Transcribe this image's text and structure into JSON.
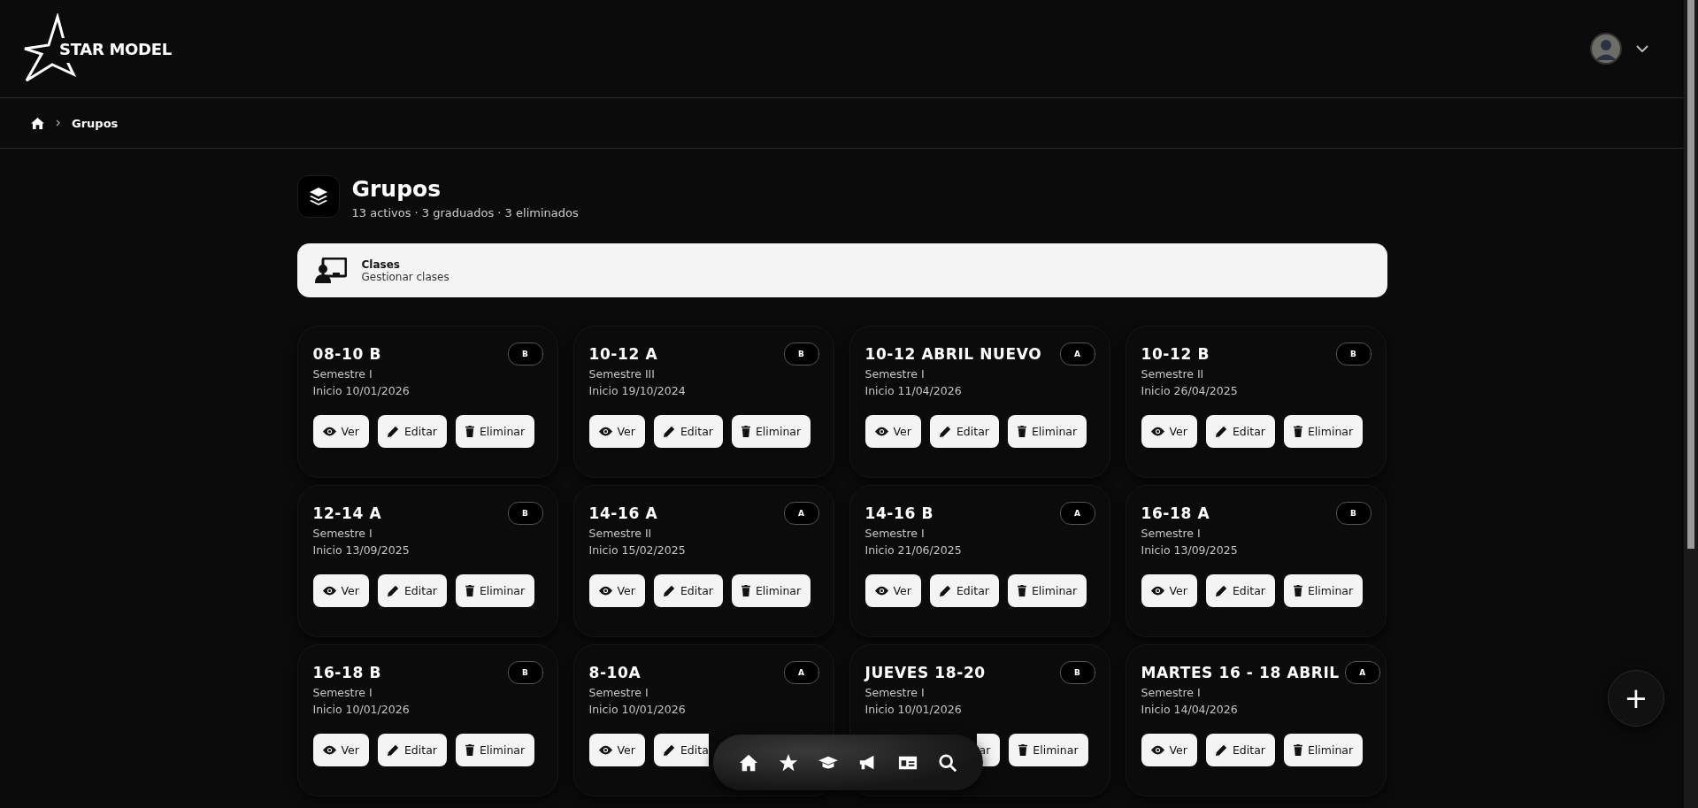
{
  "header": {
    "logo": "STAR MODEL"
  },
  "breadcrumb": {
    "current": "Grupos"
  },
  "page": {
    "title": "Grupos",
    "subtitle": "13 activos · 3 graduados · 3 eliminados"
  },
  "shortcut": {
    "title": "Clases",
    "subtitle": "Gestionar clases"
  },
  "groups": [
    {
      "name": "08-10 B",
      "badge": "B",
      "semester": "Semestre I",
      "start": "Inicio 10/01/2026",
      "actions": [
        {
          "kind": "view",
          "label": "Ver"
        },
        {
          "kind": "edit",
          "label": "Editar"
        },
        {
          "kind": "delete",
          "label": "Eliminar"
        }
      ]
    },
    {
      "name": "10-12 A",
      "badge": "B",
      "semester": "Semestre III",
      "start": "Inicio 19/10/2024",
      "actions": [
        {
          "kind": "view",
          "label": "Ver"
        },
        {
          "kind": "edit",
          "label": "Editar"
        },
        {
          "kind": "delete",
          "label": "Eliminar"
        }
      ]
    },
    {
      "name": "10-12 ABRIL NUEVO",
      "badge": "A",
      "semester": "Semestre I",
      "start": "Inicio 11/04/2026",
      "actions": [
        {
          "kind": "view",
          "label": "Ver"
        },
        {
          "kind": "edit",
          "label": "Editar"
        },
        {
          "kind": "delete",
          "label": "Eliminar"
        }
      ]
    },
    {
      "name": "10-12 B",
      "badge": "B",
      "semester": "Semestre II",
      "start": "Inicio 26/04/2025",
      "actions": [
        {
          "kind": "view",
          "label": "Ver"
        },
        {
          "kind": "edit",
          "label": "Editar"
        },
        {
          "kind": "delete",
          "label": "Eliminar"
        }
      ]
    },
    {
      "name": "12-14 A",
      "badge": "B",
      "semester": "Semestre I",
      "start": "Inicio 13/09/2025",
      "actions": [
        {
          "kind": "view",
          "label": "Ver"
        },
        {
          "kind": "edit",
          "label": "Editar"
        },
        {
          "kind": "delete",
          "label": "Eliminar"
        }
      ]
    },
    {
      "name": "14-16 A",
      "badge": "A",
      "semester": "Semestre II",
      "start": "Inicio 15/02/2025",
      "actions": [
        {
          "kind": "view",
          "label": "Ver"
        },
        {
          "kind": "edit",
          "label": "Editar"
        },
        {
          "kind": "delete",
          "label": "Eliminar"
        }
      ]
    },
    {
      "name": "14-16 B",
      "badge": "A",
      "semester": "Semestre I",
      "start": "Inicio 21/06/2025",
      "actions": [
        {
          "kind": "view",
          "label": "Ver"
        },
        {
          "kind": "edit",
          "label": "Editar"
        },
        {
          "kind": "delete",
          "label": "Eliminar"
        }
      ]
    },
    {
      "name": "16-18 A",
      "badge": "B",
      "semester": "Semestre I",
      "start": "Inicio 13/09/2025",
      "actions": [
        {
          "kind": "view",
          "label": "Ver"
        },
        {
          "kind": "edit",
          "label": "Editar"
        },
        {
          "kind": "delete",
          "label": "Eliminar"
        }
      ]
    },
    {
      "name": "16-18 B",
      "badge": "B",
      "semester": "Semestre I",
      "start": "Inicio 10/01/2026",
      "actions": [
        {
          "kind": "view",
          "label": "Ver"
        },
        {
          "kind": "edit",
          "label": "Editar"
        },
        {
          "kind": "delete",
          "label": "Eliminar"
        }
      ]
    },
    {
      "name": "8-10A",
      "badge": "A",
      "semester": "Semestre I",
      "start": "Inicio 10/01/2026",
      "actions": [
        {
          "kind": "view",
          "label": "Ver"
        },
        {
          "kind": "edit",
          "label": "Edita",
          "covered_end": true
        }
      ]
    },
    {
      "name": "JUEVES 18-20",
      "badge": "B",
      "semester": "Semestre I",
      "start": "Inicio 10/01/2026",
      "actions": [
        {
          "kind": "edit",
          "label": "ar",
          "covered_start": true
        },
        {
          "kind": "delete",
          "label": "Eliminar"
        }
      ]
    },
    {
      "name": "MARTES 16 - 18 ABRIL",
      "badge": "A",
      "semester": "Semestre I",
      "start": "Inicio 14/04/2026",
      "actions": [
        {
          "kind": "view",
          "label": "Ver"
        },
        {
          "kind": "edit",
          "label": "Editar"
        },
        {
          "kind": "delete",
          "label": "Eliminar"
        }
      ]
    }
  ],
  "dock": [
    {
      "kind": "home"
    },
    {
      "kind": "star"
    },
    {
      "kind": "cap"
    },
    {
      "kind": "megaphone"
    },
    {
      "kind": "card"
    },
    {
      "kind": "search"
    }
  ],
  "fab": {
    "label": "+"
  }
}
